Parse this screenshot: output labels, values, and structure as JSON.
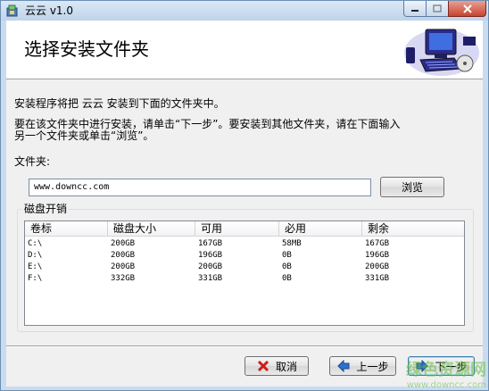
{
  "window": {
    "title": "云云 v1.0",
    "colors": {
      "accent": "#c9dcef",
      "close": "#c7442f"
    }
  },
  "header": {
    "title": "选择安装文件夹",
    "art_icon": "computer-icon"
  },
  "intro": {
    "line1": "安装程序将把 云云 安装到下面的文件夹中。",
    "line2": "要在该文件夹中进行安装，请单击“下一步”。要安装到其他文件夹，请在下面输入\n另一个文件夹或单击“浏览”。"
  },
  "folder": {
    "label": "文件夹:",
    "value": "www.downcc.com",
    "browse_label": "浏览"
  },
  "disk": {
    "group_label": "磁盘开销",
    "columns": [
      "卷标",
      "磁盘大小",
      "可用",
      "必用",
      "剩余"
    ],
    "rows": [
      [
        "C:\\",
        "200GB",
        "167GB",
        "58MB",
        "167GB"
      ],
      [
        "D:\\",
        "200GB",
        "196GB",
        "0B",
        "196GB"
      ],
      [
        "E:\\",
        "200GB",
        "200GB",
        "0B",
        "200GB"
      ],
      [
        "F:\\",
        "332GB",
        "331GB",
        "0B",
        "331GB"
      ]
    ]
  },
  "buttons": {
    "cancel": "取消",
    "prev": "上一步",
    "next": "下一步"
  },
  "watermark": {
    "text": "绿色资源网",
    "sub": "www.downcc.com"
  }
}
